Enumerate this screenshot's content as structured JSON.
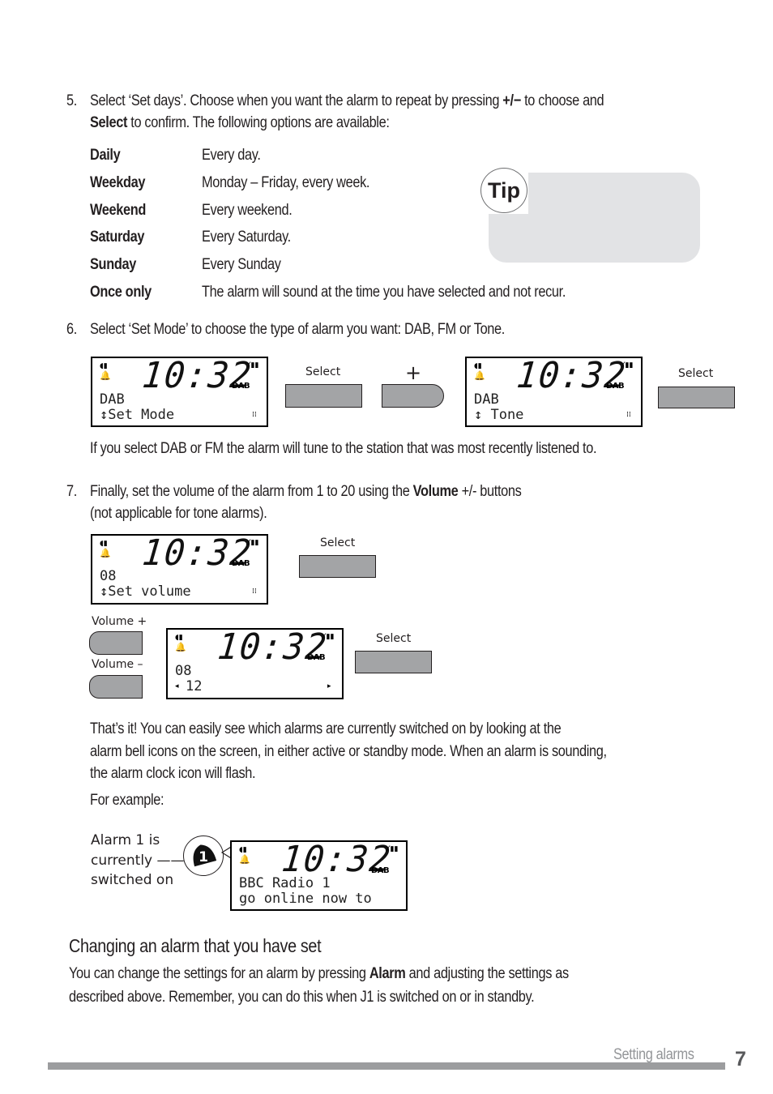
{
  "step5": {
    "number": "5.",
    "line1_a": "Select ‘Set days’. Choose when you want the alarm to repeat by pressing ",
    "line1_b": "+/−",
    "line1_c": "  to choose and",
    "line2_a": "Select",
    "line2_b": " to confirm. The following options are available:",
    "options": [
      {
        "key": "Daily",
        "value": "Every day."
      },
      {
        "key": "Weekday",
        "value": "Monday – Friday, every week."
      },
      {
        "key": "Weekend",
        "value": "Every weekend."
      },
      {
        "key": "Saturday",
        "value": "Every Saturday."
      },
      {
        "key": "Sunday",
        "value": "Every Sunday"
      },
      {
        "key": "Once only",
        "value": "The alarm will sound at the time you have selected and not recur."
      }
    ]
  },
  "tip": {
    "label": "Tip"
  },
  "step6": {
    "number": "6.",
    "text": "Select ‘Set Mode’ to choose the type of alarm you want: DAB, FM or Tone.",
    "note": "If you select DAB or FM the alarm will tune to the station that was most recently listened to.",
    "display1": {
      "time": "10:32",
      "line1": "DAB",
      "line2": "↕Set Mode",
      "badge": "DAB"
    },
    "button_select_1": "Select",
    "button_plus": "+",
    "display2": {
      "time": "10:32",
      "line1": "DAB",
      "line2": "↕ Tone",
      "badge": "DAB"
    },
    "button_select_2": "Select"
  },
  "step7": {
    "number": "7.",
    "line1_a": "Finally, set the volume of the alarm from 1 to 20 using the ",
    "line1_b": "Volume",
    "line1_c": " +/-  buttons",
    "line2": "(not applicable for tone alarms).",
    "display1": {
      "time": "10:32",
      "line1": "08",
      "line2": "↕Set volume",
      "badge": "DAB"
    },
    "button_select_1": "Select",
    "volume_plus_label": "Volume +",
    "volume_minus_label": "Volume –",
    "display2": {
      "time": "10:32",
      "line1": "08",
      "line2": "12",
      "badge": "DAB"
    },
    "button_select_2": "Select"
  },
  "summary": {
    "line1": "That’s it! You can easily see which alarms are currently switched on by looking at the",
    "line2": "alarm bell icons on the screen, in either active or standby mode. When an alarm is sounding,",
    "line3": "the alarm clock icon will flash.",
    "example_label": "For example:",
    "callout": [
      "Alarm 1 is",
      "currently ——",
      "switched on"
    ],
    "bell_number": "1",
    "display": {
      "time": "10:32",
      "line1": "BBC Radio 1",
      "line2": "go online now to",
      "badge": "DAB"
    }
  },
  "changing": {
    "heading": "Changing an alarm that you have set",
    "line1_a": "You can change the settings for an alarm by pressing ",
    "line1_b": "Alarm",
    "line1_c": " and adjusting the settings as",
    "line2": "described above.  Remember, you can do this when J1 is switched on or in standby."
  },
  "footer": {
    "section": "Setting alarms",
    "page": "7"
  }
}
